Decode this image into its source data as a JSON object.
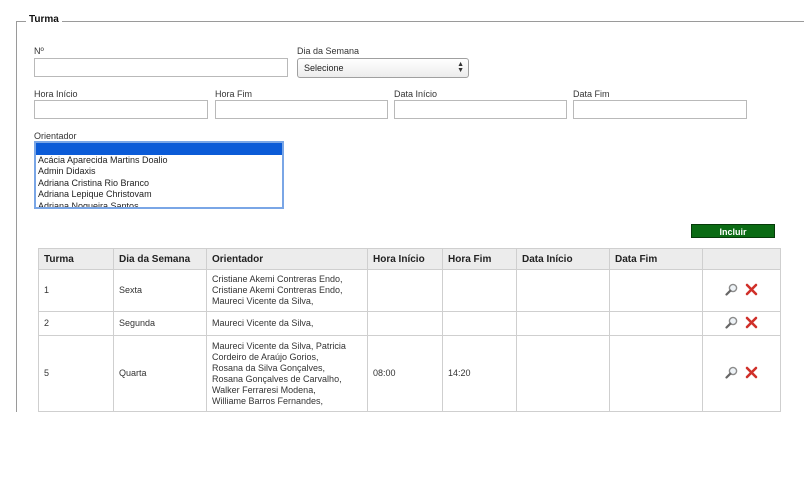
{
  "form": {
    "legend": "Turma",
    "numero_label": "Nº",
    "numero_value": "",
    "dia_semana_label": "Dia da Semana",
    "dia_semana_selected": "Selecione",
    "hora_inicio_label": "Hora Início",
    "hora_inicio_value": "",
    "hora_fim_label": "Hora Fim",
    "hora_fim_value": "",
    "data_inicio_label": "Data Início",
    "data_inicio_value": "",
    "data_fim_label": "Data Fim",
    "data_fim_value": "",
    "orientador_label": "Orientador",
    "orientador_options": [
      "",
      "Acácia Aparecida Martins Doalio",
      "Admin Didaxis",
      "Adriana Cristina Rio Branco",
      "Adriana Lepique Christovam",
      "Adriana Nogueira Santos"
    ],
    "incluir_label": "Incluir"
  },
  "table": {
    "columns": [
      "Turma",
      "Dia da Semana",
      "Orientador",
      "Hora Início",
      "Hora Fim",
      "Data Início",
      "Data Fim",
      ""
    ],
    "rows": [
      {
        "turma": "1",
        "dia": "Sexta",
        "orientador": [
          "Cristiane Akemi Contreras Endo,",
          "Cristiane Akemi Contreras Endo,",
          "Maureci Vicente da Silva,"
        ],
        "hora_inicio": "",
        "hora_fim": "",
        "data_inicio": "",
        "data_fim": ""
      },
      {
        "turma": "2",
        "dia": "Segunda",
        "orientador": [
          "Maureci Vicente da Silva,"
        ],
        "hora_inicio": "",
        "hora_fim": "",
        "data_inicio": "",
        "data_fim": ""
      },
      {
        "turma": "5",
        "dia": "Quarta",
        "orientador": [
          "Maureci Vicente da Silva, Patricia",
          "Cordeiro de Araújo Gorios,",
          "Rosana da Silva Gonçalves,",
          "Rosana Gonçalves de Carvalho,",
          "Walker Ferraresi Modena,",
          "Williame Barros Fernandes,"
        ],
        "hora_inicio": "08:00",
        "hora_fim": "14:20",
        "data_inicio": "",
        "data_fim": ""
      },
      {
        "turma": "",
        "dia": "",
        "orientador": [
          ""
        ],
        "hora_inicio": "",
        "hora_fim": "",
        "data_inicio": "",
        "data_fim": ""
      }
    ]
  },
  "icons": {
    "edit": "magnifier-icon",
    "delete": "delete-x-icon"
  },
  "colors": {
    "button_green": "#0b6b14",
    "listbox_selected": "#0b5bd7",
    "delete_red": "#d0302a"
  }
}
